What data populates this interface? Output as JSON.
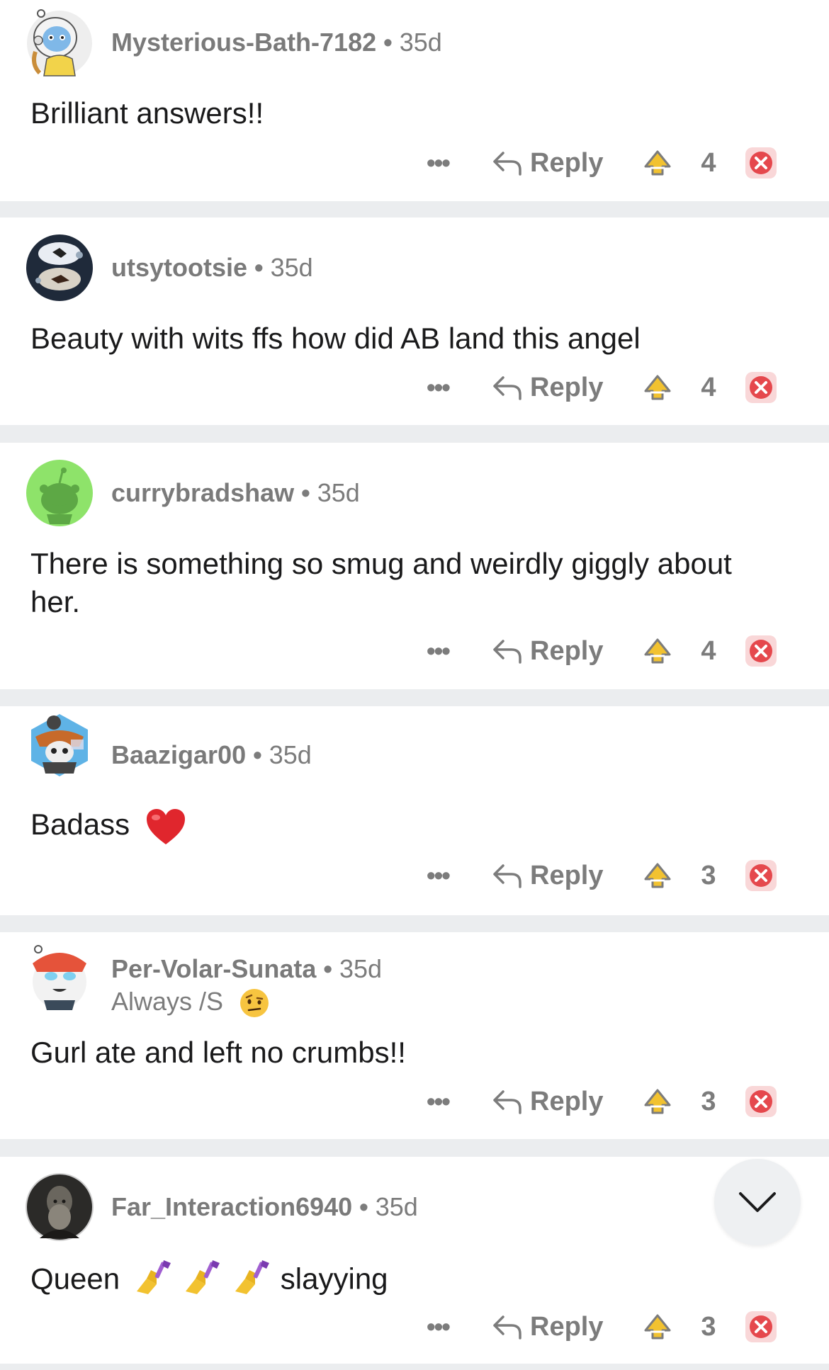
{
  "comments": [
    {
      "username": "Mysterious-Bath-7182",
      "age": "35d",
      "body": "Brilliant answers!!",
      "more_label": "•••",
      "reply_label": "Reply",
      "score": "4"
    },
    {
      "username": "utsytootsie",
      "age": "35d",
      "body": "Beauty with wits ffs how did AB land this angel",
      "more_label": "•••",
      "reply_label": "Reply",
      "score": "4"
    },
    {
      "username": "currybradshaw",
      "age": "35d",
      "body": "There is something so smug and weirdly giggly about her.",
      "more_label": "•••",
      "reply_label": "Reply",
      "score": "4"
    },
    {
      "username": "Baazigar00",
      "age": "35d",
      "body": "Badass",
      "body_emoji": "red-heart-emoji",
      "more_label": "•••",
      "reply_label": "Reply",
      "score": "3"
    },
    {
      "username": "Per-Volar-Sunata",
      "age": "35d",
      "flair": "Always /S",
      "flair_emoji": "face-with-raised-eyebrow-emoji",
      "body": "Gurl ate and left no crumbs!!",
      "more_label": "•••",
      "reply_label": "Reply",
      "score": "3"
    },
    {
      "username": "Far_Interaction6940",
      "age": "35d",
      "body_prefix": "Queen",
      "body_emoji": "nail-polish-emoji",
      "body_suffix": "slayying",
      "more_label": "•••",
      "reply_label": "Reply",
      "score": "3"
    }
  ],
  "separator": "•",
  "colors": {
    "meta_text": "#7c7c7c",
    "downvote_active": "#e5484d",
    "upvote_gold": "#f2c230",
    "divider": "#ebedef"
  },
  "scroll_button": {
    "icon": "chevron-down-icon"
  }
}
